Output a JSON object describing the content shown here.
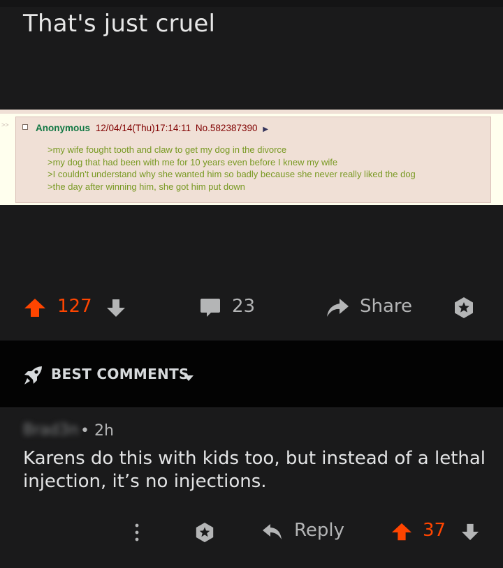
{
  "post": {
    "title": "That's just cruel",
    "screenshot": {
      "chevrons": ">>",
      "name": "Anonymous",
      "date": "12/04/14(Thu)17:14:11",
      "number": "No.582387390",
      "arrow": "▶",
      "lines": [
        ">my wife fought tooth and claw to get my dog in the divorce",
        ">my dog that had been with me for 10 years even before I knew my wife",
        ">I couldn't understand why she wanted him so badly because she never really liked the dog",
        ">the day after winning him, she got him put down"
      ]
    },
    "actions": {
      "vote_count": "127",
      "comment_count": "23",
      "share_label": "Share"
    }
  },
  "sort": {
    "label": "BEST COMMENTS"
  },
  "comment": {
    "author": "Brad3n",
    "meta": "• 2h",
    "body": "Karens do this with kids too, but instead of a lethal injection, it’s no injections.",
    "reply_label": "Reply",
    "vote_count": "37"
  },
  "colors": {
    "background": "#1a1a1b",
    "upvote": "#ff4500",
    "icon_gray": "#b4b5b6",
    "greentext": "#789922",
    "anon_name": "#117743"
  }
}
